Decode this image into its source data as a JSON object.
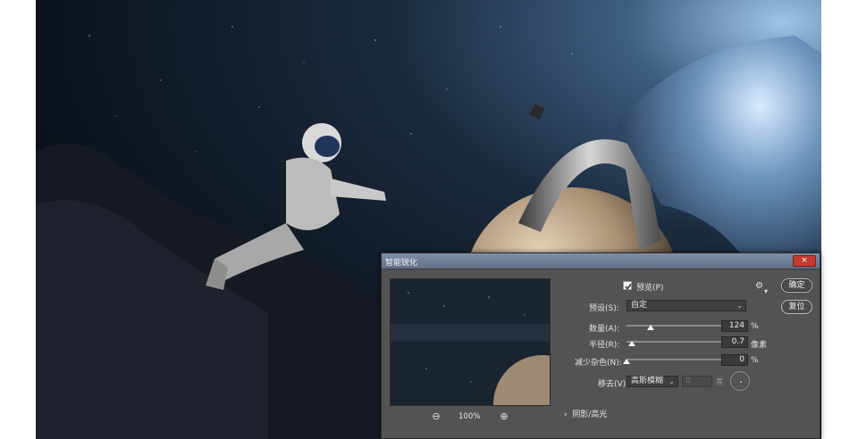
{
  "dialog": {
    "title": "智能锐化",
    "close_label": "×",
    "zoom_out_icon": "zoom-out-icon",
    "zoom_in_icon": "zoom-in-icon",
    "zoom_level": "100%",
    "preview_label": "预览(P)",
    "preview_checked": true,
    "preset_label": "预设(S):",
    "preset_value": "自定",
    "ok_label": "确定",
    "reset_label": "复位",
    "amount": {
      "label": "数量(A):",
      "value": "124",
      "unit": "%",
      "level": 0.25
    },
    "radius": {
      "label": "半径(R):",
      "value": "0.7",
      "unit": "像素",
      "level": 0.06
    },
    "noise": {
      "label": "减少杂色(N):",
      "value": "0",
      "unit": "%",
      "level": 0.0
    },
    "remove": {
      "label": "移去(V):",
      "value": "高斯模糊",
      "angle_value": "0",
      "angle_unit": "度"
    },
    "shadows_highlights": "阴影/高光"
  },
  "colors": {
    "highlight": "#ea1e1e",
    "dialog_bg": "#535353"
  }
}
